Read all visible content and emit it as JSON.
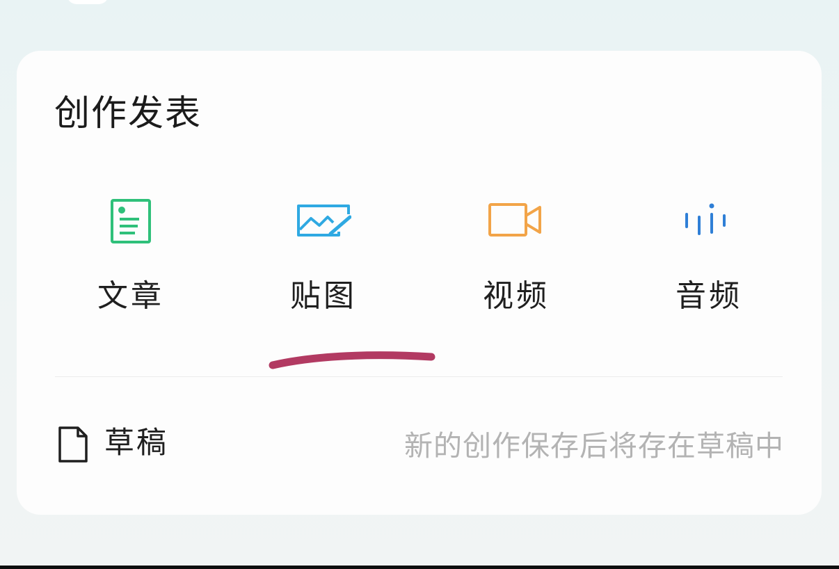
{
  "panel": {
    "title": "创作发表"
  },
  "tools": [
    {
      "label": "文章",
      "icon": "article-icon",
      "color": "#2fc07a"
    },
    {
      "label": "贴图",
      "icon": "image-icon",
      "color": "#2fa9e2"
    },
    {
      "label": "视频",
      "icon": "video-camera-icon",
      "color": "#f2a448"
    },
    {
      "label": "音频",
      "icon": "audio-waveform-icon",
      "color": "#2f7fd6"
    }
  ],
  "drafts": {
    "label": "草稿",
    "hint": "新的创作保存后将存在草稿中",
    "icon": "document-icon"
  },
  "annotation": {
    "icon": "handwritten-underline",
    "color": "#b23a62"
  }
}
